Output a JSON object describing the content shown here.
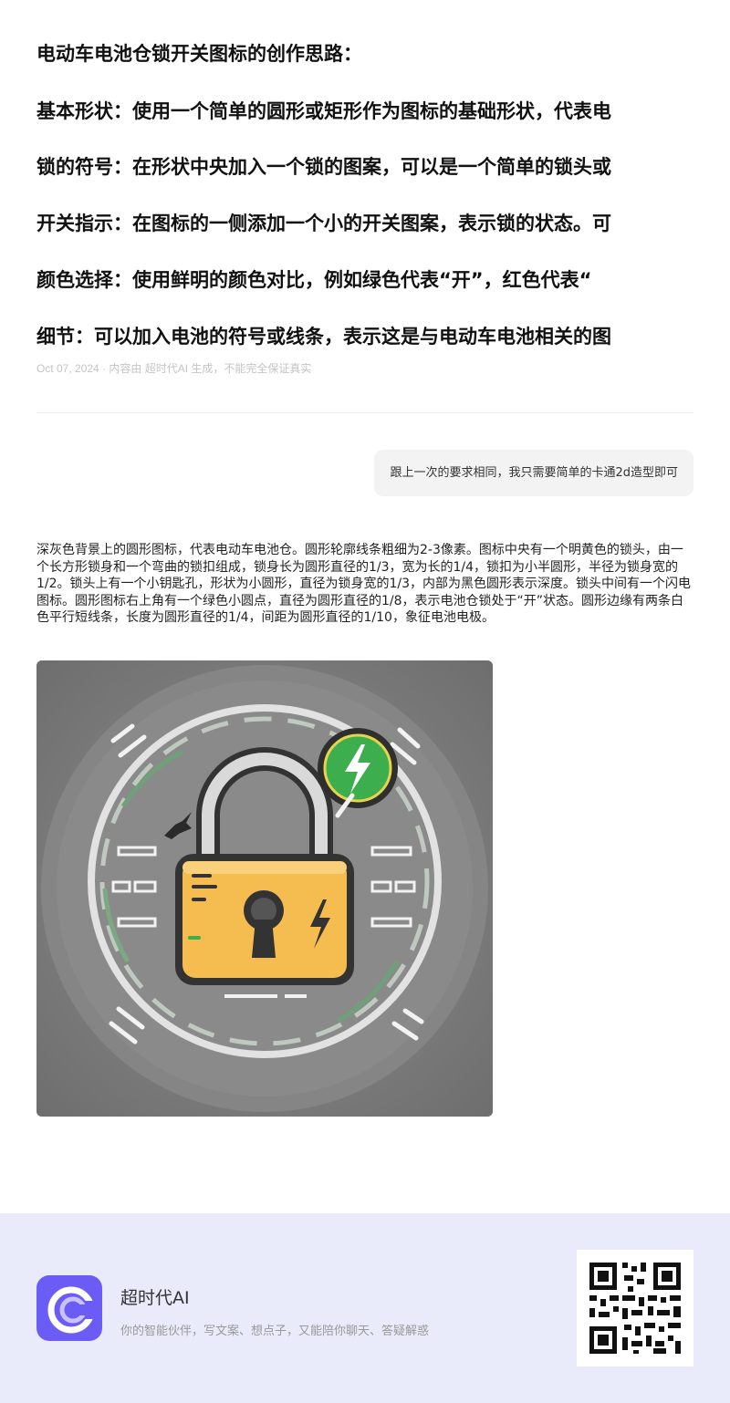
{
  "article": {
    "lines": [
      "电动车电池仓锁开关图标的创作思路：",
      "基本形状：使用一个简单的圆形或矩形作为图标的基础形状，代表电",
      "锁的符号：在形状中央加入一个锁的图案，可以是一个简单的锁头或",
      "开关指示：在图标的一侧添加一个小的开关图案，表示锁的状态。可",
      "颜色选择：使用鲜明的颜色对比，例如绿色代表“开”，红色代表“",
      "细节：可以加入电池的符号或线条，表示这是与电动车电池相关的图"
    ],
    "meta": "Oct 07, 2024 · 内容由 超时代AI 生成，不能完全保证真实"
  },
  "chat": {
    "user_message": "跟上一次的要求相同，我只需要简单的卡通2d造型即可",
    "ai_description": "深灰色背景上的圆形图标，代表电动车电池仓。圆形轮廓线条粗细为2-3像素。图标中央有一个明黄色的锁头，由一个长方形锁身和一个弯曲的锁扣组成，锁身长为圆形直径的1/3，宽为长的1/4，锁扣为小半圆形，半径为锁身宽的1/2。锁头上有一个小钥匙孔，形状为小圆形，直径为锁身宽的1/3，内部为黑色圆形表示深度。锁头中间有一个闪电图标。圆形图标右上角有一个绿色小圆点，直径为圆形直径的1/8，表示电池仓锁处于“开”状态。圆形边缘有两条白色平行短线条，长度为圆形直径的1/4，间距为圆形直径的1/10，象征电池电极。"
  },
  "footer": {
    "brand_name": "超时代AI",
    "tagline": "你的智能伙伴，写文案、想点子，又能陪你聊天、答疑解惑"
  },
  "colors": {
    "lock_yellow": "#f5bd4f",
    "status_green": "#3cae4e",
    "art_background": "#7b7b7b",
    "logo_purple": "#6b5cf5",
    "footer_bg": "#e9ebfa"
  },
  "icons": [
    "padlock-icon",
    "lightning-icon",
    "keyhole-icon",
    "brand-logo-icon",
    "qr-code"
  ]
}
